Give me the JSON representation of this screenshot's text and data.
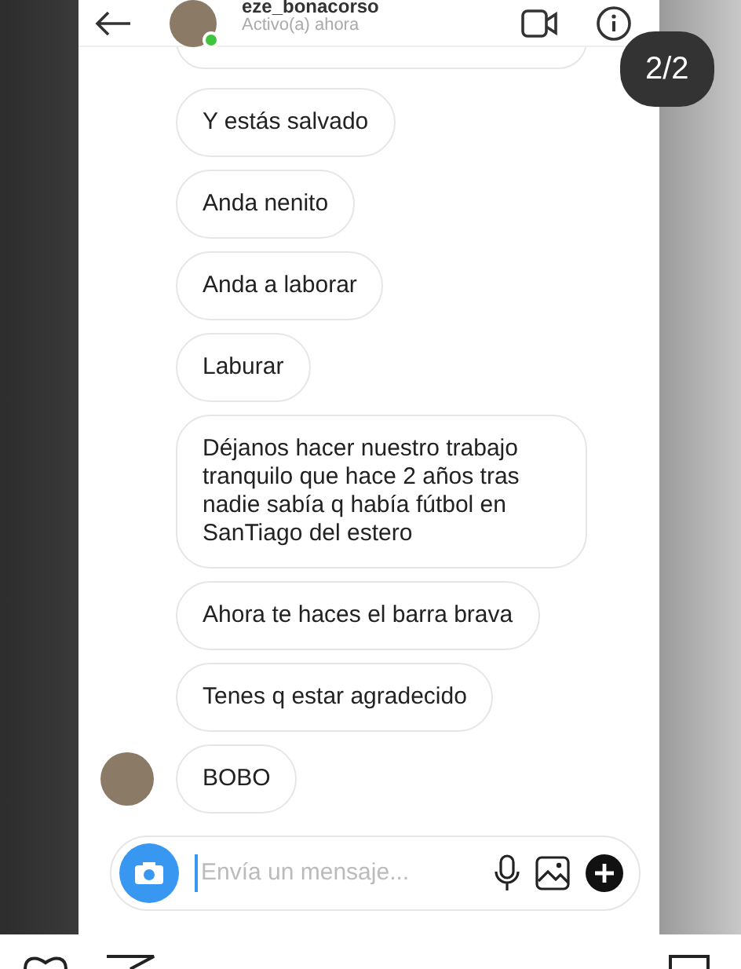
{
  "header": {
    "username": "eze_bonacorso",
    "status": "Activo(a) ahora",
    "online": true
  },
  "story_counter": "2/2",
  "messages": [
    {
      "text": "Y estás salvado",
      "avatar": false
    },
    {
      "text": "Anda nenito",
      "avatar": false
    },
    {
      "text": "Anda a laborar",
      "avatar": false
    },
    {
      "text": "Laburar",
      "avatar": false
    },
    {
      "text": "Déjanos hacer nuestro trabajo tranquilo que hace 2 años tras nadie sabía q había fútbol en SanTiago del estero",
      "avatar": false
    },
    {
      "text": "Ahora te haces el barra brava",
      "avatar": false
    },
    {
      "text": "Tenes q estar agradecido",
      "avatar": false
    },
    {
      "text": "BOBO",
      "avatar": true
    }
  ],
  "composer": {
    "placeholder": "Envía un mensaje..."
  }
}
